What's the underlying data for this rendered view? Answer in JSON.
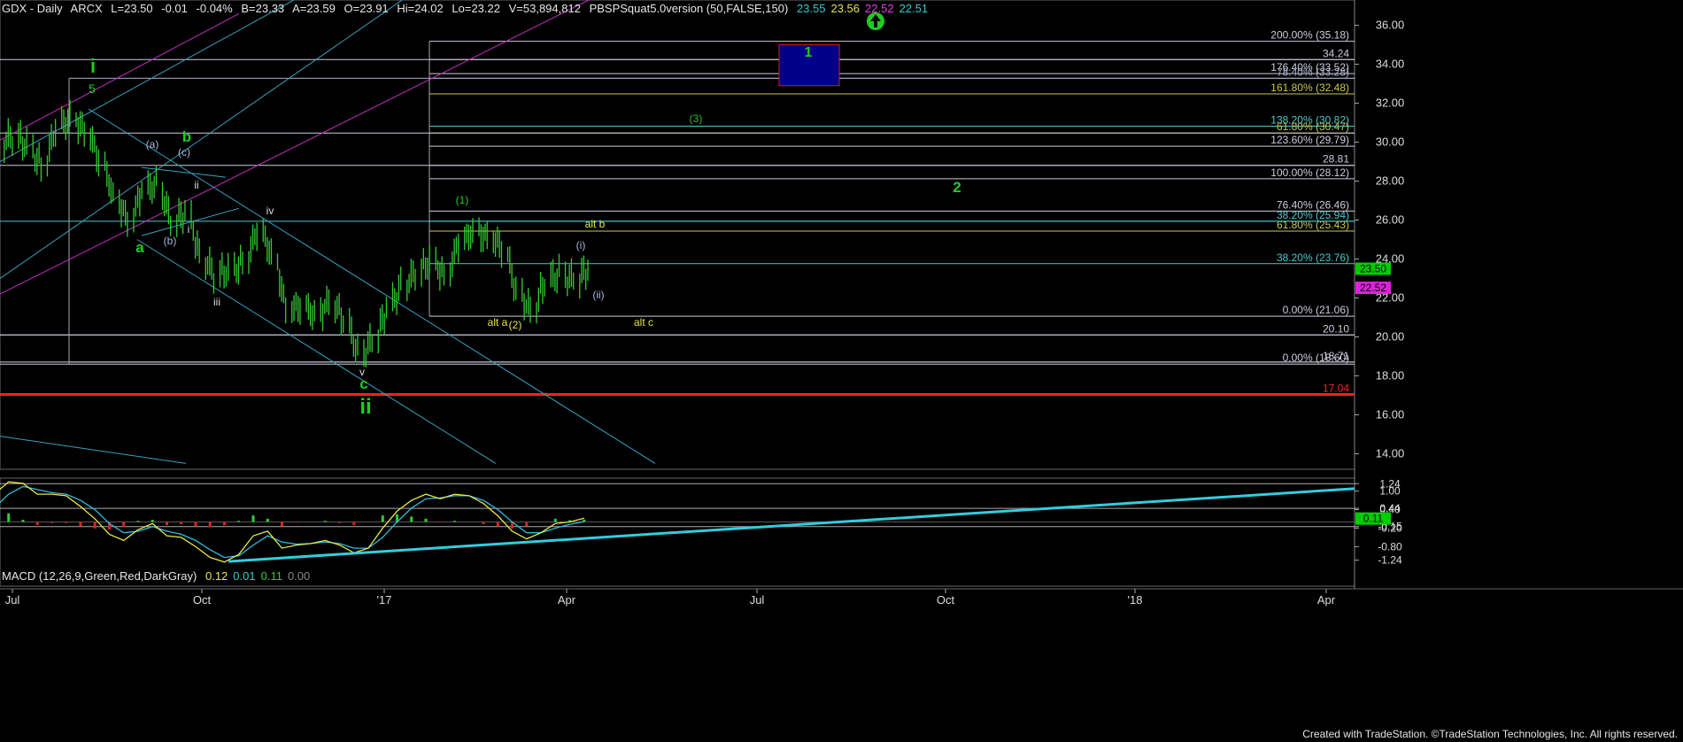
{
  "header": {
    "symbol": "GDX - Daily",
    "exchange": "ARCX",
    "last": "L=23.50",
    "change": "-0.01",
    "change_pct": "-0.04%",
    "bid": "B=23.33",
    "ask": "A=23.59",
    "open": "O=23.91",
    "high": "Hi=24.02",
    "low": "Lo=23.22",
    "volume": "V=53,894,812",
    "indicator": "PBSPSquat5.0version (50,FALSE,150)",
    "ind_values": [
      {
        "text": "23.55",
        "color": "#33cccc"
      },
      {
        "text": "23.56",
        "color": "#e6e64d"
      },
      {
        "text": "22.52",
        "color": "#e040e0"
      },
      {
        "text": "22.51",
        "color": "#33cccc"
      }
    ]
  },
  "macd_header": {
    "name": "MACD (12,26,9,Green,Red,DarkGray)",
    "values": [
      {
        "text": "0.12",
        "color": "#e6e64d"
      },
      {
        "text": "0.01",
        "color": "#33cccc"
      },
      {
        "text": "0.11",
        "color": "#33cc33"
      },
      {
        "text": "0.00",
        "color": "#888888"
      }
    ]
  },
  "footer": "Created with TradeStation. ©TradeStation Technologies, Inc. All rights reserved.",
  "chart_data": [
    {
      "type": "candlestick",
      "title": "GDX - Daily",
      "x_ticks": [
        "Jul",
        "Oct",
        "'17",
        "Apr",
        "Jul",
        "Oct",
        "'18",
        "Apr"
      ],
      "y_ticks": [
        14,
        16,
        18,
        20,
        22,
        24,
        26,
        28,
        30,
        32,
        34,
        36
      ],
      "ylim": [
        13.2,
        37.3
      ],
      "last_price": 23.5,
      "price_tags": [
        {
          "text": "23.50",
          "value": 23.5,
          "bg": "#00cc00"
        },
        {
          "text": "22.52",
          "value": 22.52,
          "bg": "#e020e0"
        }
      ],
      "series": [
        {
          "name": "close",
          "x": [
            "2016-06-13",
            "2016-06-20",
            "2016-06-27",
            "2016-07-04",
            "2016-07-11",
            "2016-07-18",
            "2016-07-25",
            "2016-08-01",
            "2016-08-08",
            "2016-08-15",
            "2016-08-22",
            "2016-08-29",
            "2016-09-05",
            "2016-09-12",
            "2016-09-19",
            "2016-09-26",
            "2016-10-03",
            "2016-10-10",
            "2016-10-17",
            "2016-10-24",
            "2016-10-31",
            "2016-11-07",
            "2016-11-14",
            "2016-11-21",
            "2016-11-28",
            "2016-12-05",
            "2016-12-12",
            "2016-12-19",
            "2016-12-26",
            "2017-01-02",
            "2017-01-09",
            "2017-01-16",
            "2017-01-23",
            "2017-01-30",
            "2017-02-06",
            "2017-02-13",
            "2017-02-20",
            "2017-02-27",
            "2017-03-06",
            "2017-03-13",
            "2017-03-20",
            "2017-03-27",
            "2017-04-03"
          ],
          "values": [
            27.8,
            29.9,
            30.3,
            29.8,
            28.7,
            30.8,
            31.2,
            30.6,
            29.1,
            27.2,
            25.9,
            27.6,
            27.8,
            25.9,
            26.4,
            24.1,
            23.2,
            23.4,
            23.8,
            25.5,
            24.2,
            21.4,
            21.6,
            21.1,
            21.8,
            20.9,
            19.1,
            19.8,
            21.5,
            22.6,
            23.3,
            23.9,
            23.1,
            24.9,
            25.4,
            25.1,
            24.6,
            22.3,
            21.3,
            22.9,
            23.2,
            22.9,
            23.5
          ]
        }
      ],
      "fib_levels": [
        {
          "label": "200.00% (35.18)",
          "value": 35.18
        },
        {
          "label": "34.24",
          "value": 34.24
        },
        {
          "label": "176.40% (33.52)",
          "value": 33.52
        },
        {
          "label": "78.40% (33.28)",
          "value": 33.28
        },
        {
          "label": "161.80% (32.48)",
          "value": 32.48
        },
        {
          "label": "138.20% (30.82)",
          "value": 30.82
        },
        {
          "label": "61.80% (30.47)",
          "value": 30.47
        },
        {
          "label": "123.60% (29.79)",
          "value": 29.79
        },
        {
          "label": "28.81",
          "value": 28.81
        },
        {
          "label": "100.00% (28.12)",
          "value": 28.12
        },
        {
          "label": "76.40% (26.46)",
          "value": 26.46
        },
        {
          "label": "38.20% (25.94)",
          "value": 25.94
        },
        {
          "label": "61.80% (25.43)",
          "value": 25.43
        },
        {
          "label": "38.20% (23.76)",
          "value": 23.76
        },
        {
          "label": "0.00% (21.06)",
          "value": 21.06
        },
        {
          "label": "20.10",
          "value": 20.1
        },
        {
          "label": "18.71",
          "value": 18.71
        },
        {
          "label": "0.00% (18.60)",
          "value": 18.6
        },
        {
          "label": "17.04",
          "value": 17.04
        }
      ],
      "wave_labels": [
        {
          "text": "i",
          "color": "#22cc22"
        },
        {
          "text": "5",
          "color": "#22cc22"
        },
        {
          "text": "(a)",
          "color": "#aab4dd"
        },
        {
          "text": "b",
          "color": "#22cc22"
        },
        {
          "text": "(c)",
          "color": "#aab4dd"
        },
        {
          "text": "ii",
          "color": "#dddddd"
        },
        {
          "text": "i",
          "color": "#dddddd"
        },
        {
          "text": "(b)",
          "color": "#aab4dd"
        },
        {
          "text": "a",
          "color": "#22cc22"
        },
        {
          "text": "iii",
          "color": "#dddddd"
        },
        {
          "text": "iv",
          "color": "#dddddd"
        },
        {
          "text": "v",
          "color": "#dddddd"
        },
        {
          "text": "c",
          "color": "#22cc22"
        },
        {
          "text": "ii",
          "color": "#22cc22"
        },
        {
          "text": "(1)",
          "color": "#22cc22"
        },
        {
          "text": "(2)",
          "color": "#e6e64d"
        },
        {
          "text": "alt a",
          "color": "#e6e64d"
        },
        {
          "text": "alt b",
          "color": "#e6e64d"
        },
        {
          "text": "(i)",
          "color": "#aab4dd"
        },
        {
          "text": "(ii)",
          "color": "#aab4dd"
        },
        {
          "text": "alt c",
          "color": "#e6e64d"
        },
        {
          "text": "(3)",
          "color": "#33bb33"
        },
        {
          "text": "1",
          "color": "#22cc22"
        },
        {
          "text": "2",
          "color": "#22cc22"
        }
      ]
    },
    {
      "type": "macd",
      "title": "MACD (12,26,9,Green,Red,DarkGray)",
      "y_ticks": [
        {
          "text": "1.24",
          "value": 1.24
        },
        {
          "text": "1.00",
          "value": 1.0
        },
        {
          "text": "0.44",
          "value": 0.44
        },
        {
          "text": "0.40",
          "value": 0.4
        },
        {
          "text": "-0.15",
          "value": -0.15
        },
        {
          "text": "-0.20",
          "value": -0.2
        },
        {
          "text": "-0.80",
          "value": -0.8
        },
        {
          "text": "-1.24",
          "value": -1.24
        }
      ],
      "ylim": [
        -1.45,
        1.42
      ],
      "last_value": {
        "text": "0.11",
        "value": 0.11,
        "bg": "#00cc00"
      },
      "series": [
        {
          "name": "macd",
          "values": [
            0.3,
            0.9,
            1.3,
            1.25,
            0.9,
            0.9,
            0.85,
            0.5,
            0.1,
            -0.4,
            -0.6,
            -0.25,
            -0.05,
            -0.45,
            -0.5,
            -0.8,
            -1.15,
            -1.3,
            -1.05,
            -0.45,
            -0.3,
            -0.85,
            -0.75,
            -0.7,
            -0.6,
            -0.75,
            -1.0,
            -0.85,
            -0.2,
            0.35,
            0.7,
            0.9,
            0.75,
            0.9,
            0.85,
            0.6,
            0.2,
            -0.3,
            -0.55,
            -0.35,
            -0.05,
            0.0,
            0.12
          ]
        },
        {
          "name": "signal",
          "values": [
            0.1,
            0.45,
            0.9,
            1.15,
            1.05,
            0.95,
            0.9,
            0.7,
            0.4,
            -0.05,
            -0.35,
            -0.3,
            -0.15,
            -0.3,
            -0.4,
            -0.6,
            -0.9,
            -1.15,
            -1.1,
            -0.75,
            -0.45,
            -0.65,
            -0.72,
            -0.7,
            -0.65,
            -0.7,
            -0.85,
            -0.85,
            -0.5,
            0.0,
            0.45,
            0.75,
            0.78,
            0.85,
            0.85,
            0.7,
            0.4,
            0.0,
            -0.35,
            -0.35,
            -0.2,
            -0.08,
            0.01
          ]
        }
      ]
    }
  ]
}
